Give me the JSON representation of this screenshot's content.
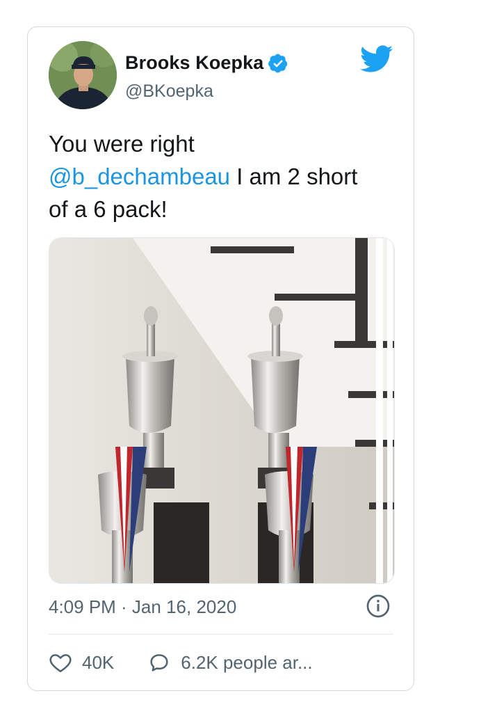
{
  "author": {
    "name": "Brooks Koepka",
    "handle": "@BKoepka",
    "verified_icon": "verified-badge-icon"
  },
  "tweet": {
    "text_before": "You were right",
    "mention": "@b_dechambeau",
    "text_after": " I am 2 short of a 6 pack!",
    "timestamp": "4:09 PM · Jan 16, 2020"
  },
  "actions": {
    "likes": "40K",
    "replies": "6.2K people ar..."
  },
  "colors": {
    "accent": "#1da1f2",
    "link": "#1b95e0",
    "muted": "#536471"
  }
}
